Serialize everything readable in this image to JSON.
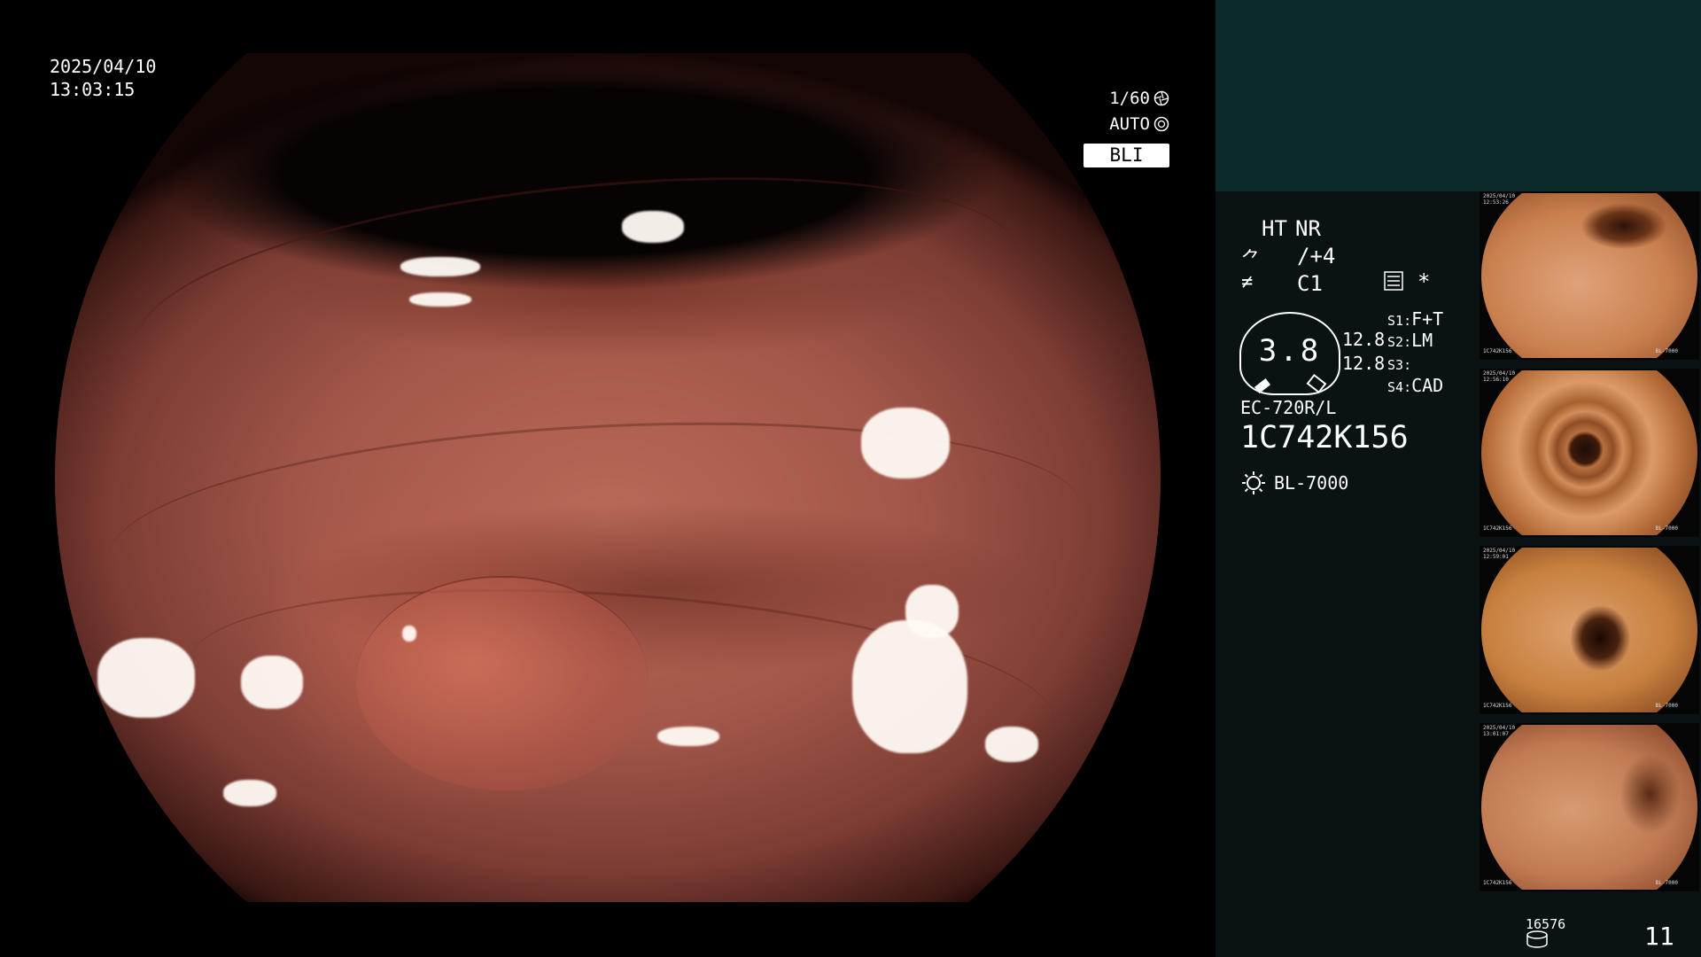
{
  "overlay": {
    "date": "2025/04/10",
    "time": "13:03:15",
    "shutter": "1/60",
    "shutter_icon": "shutter-icon",
    "iris": "AUTO",
    "iris_icon": "iris-icon",
    "mode": "BLI"
  },
  "panel": {
    "ht": "HT",
    "nr": "NR",
    "enhancement_icon": "structure-enhancement-icon",
    "enhancement": "/+4",
    "color_icon": "color-mode-icon",
    "color_mode": "C1",
    "menu_icon": "menu-list-icon",
    "asterisk": "*",
    "zoom": "3.8",
    "zoom_top": "12.8",
    "zoom_bottom": "12.8",
    "slots": [
      {
        "key": "S1",
        "value": "F+T"
      },
      {
        "key": "S2",
        "value": "LM"
      },
      {
        "key": "S3",
        "value": ""
      },
      {
        "key": "S4",
        "value": "CAD"
      }
    ],
    "scope_model": "EC-720R/L",
    "scope_serial": "1C742K156",
    "light_icon": "light-source-icon",
    "light_model": "BL-7000",
    "footer_count": "16576",
    "database_icon": "database-icon",
    "frame_number": "11"
  },
  "colors": {
    "ht_accent": "#f5a623",
    "panel_top": "#0d2a2b",
    "panel_bg": "#0a1213"
  },
  "thumbnails": [
    {
      "date": "2025/04/10",
      "time": "12:53:26",
      "serial": "1C742K156",
      "light": "BL-7000"
    },
    {
      "date": "2025/04/10",
      "time": "12:56:10",
      "serial": "1C742K156",
      "light": "BL-7000"
    },
    {
      "date": "2025/04/10",
      "time": "12:59:01",
      "serial": "1C742K156",
      "light": "BL-7000"
    },
    {
      "date": "2025/04/10",
      "time": "13:01:07",
      "serial": "1C742K156",
      "light": "BL-7000"
    }
  ]
}
